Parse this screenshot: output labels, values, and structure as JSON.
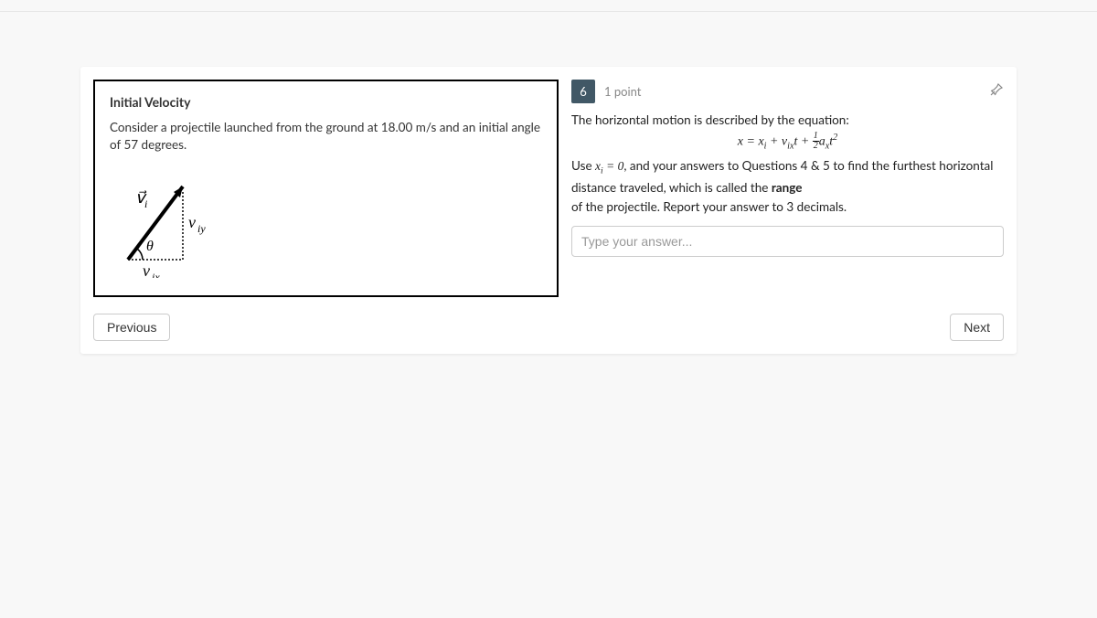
{
  "left": {
    "title": "Initial Velocity",
    "description": "Consider a projectile launched from the ground at 18.00 m/s and an initial angle of 57 degrees.",
    "diagram": {
      "vi_label": "v",
      "viy_label": "v",
      "vix_label": "v",
      "theta_label": "θ"
    }
  },
  "question": {
    "number": "6",
    "points": "1 point",
    "line1": "The horizontal motion is described by the equation:",
    "line2a": "Use ",
    "line2b": ", and your answers to Questions 4 & 5 to find the furthest horizontal",
    "line3": "distance traveled, which is called the ",
    "range_word": "range",
    "line4": "of the projectile. Report your answer to 3 decimals.",
    "placeholder": "Type your answer..."
  },
  "nav": {
    "prev": "Previous",
    "next": "Next"
  }
}
